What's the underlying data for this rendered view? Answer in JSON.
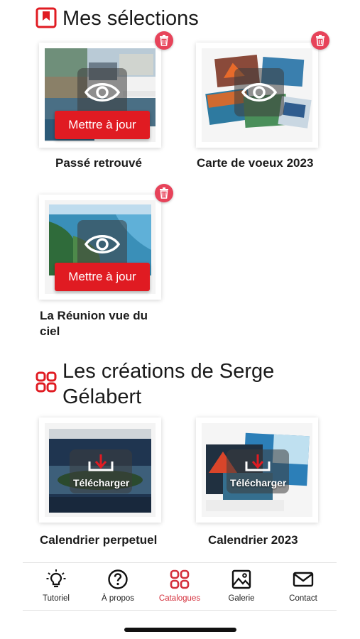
{
  "colors": {
    "accent": "#e01b22",
    "delete": "#e7435a",
    "activeTab": "#d4303c"
  },
  "selections": {
    "title": "Mes sélections",
    "icon": "bookmark-icon",
    "items": [
      {
        "title": "Passé retrouvé",
        "button": "Mettre à jour"
      },
      {
        "title": "Carte de voeux 2023"
      },
      {
        "title": "La Réunion vue du ciel",
        "button": "Mettre à jour"
      }
    ]
  },
  "creations": {
    "title": "Les créations de Serge Gélabert",
    "icon": "grid-icon",
    "items": [
      {
        "title": "Calendrier perpetuel",
        "action": "Télécharger"
      },
      {
        "title": "Calendrier 2023",
        "action": "Télécharger"
      }
    ]
  },
  "tabbar": {
    "items": [
      {
        "label": "Tutoriel",
        "icon": "lightbulb-icon"
      },
      {
        "label": "À propos",
        "icon": "question-icon"
      },
      {
        "label": "Catalogues",
        "icon": "grid-icon",
        "active": true
      },
      {
        "label": "Galerie",
        "icon": "image-icon"
      },
      {
        "label": "Contact",
        "icon": "mail-icon"
      }
    ]
  }
}
